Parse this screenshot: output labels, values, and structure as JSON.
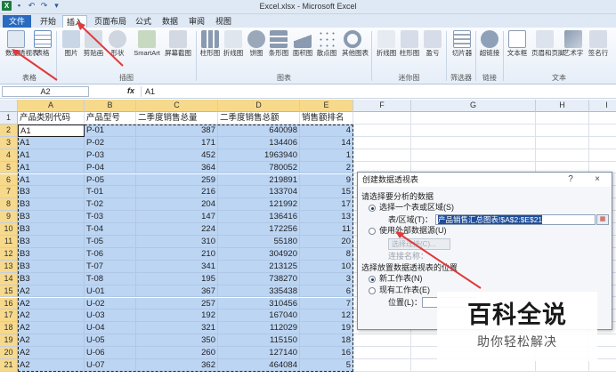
{
  "window": {
    "title": "Excel.xlsx - Microsoft Excel"
  },
  "tabs": [
    "文件",
    "开始",
    "插入",
    "页面布局",
    "公式",
    "数据",
    "审阅",
    "视图"
  ],
  "active_tab": "插入",
  "ribbon": {
    "buttons": [
      "数据透视表",
      "表格",
      "图片",
      "剪贴画",
      "形状",
      "SmartArt",
      "屏幕截图",
      "柱形图",
      "折线图",
      "饼图",
      "条形图",
      "面积图",
      "散点图",
      "其他图表",
      "折线图",
      "柱形图",
      "盈亏",
      "切片器",
      "超链接",
      "文本框",
      "页眉和页脚",
      "艺术字",
      "签名行"
    ],
    "groups": [
      "表格",
      "插图",
      "图表",
      "迷你图",
      "筛选器",
      "链接",
      "文本"
    ]
  },
  "formula_bar": {
    "name_box": "A2",
    "fx": "fx",
    "content": "A1"
  },
  "columns": [
    "A",
    "B",
    "C",
    "D",
    "E",
    "F",
    "G",
    "H",
    "I"
  ],
  "rows": [
    "1",
    "2",
    "3",
    "4",
    "5",
    "6",
    "7",
    "8",
    "9",
    "10",
    "11",
    "12",
    "13",
    "14",
    "15",
    "16",
    "17",
    "18",
    "19",
    "20",
    "21"
  ],
  "headers": [
    "产品类别代码",
    "产品型号",
    "二季度销售总量",
    "二季度销售总额",
    "销售额排名"
  ],
  "table": [
    [
      "A1",
      "P-01",
      "387",
      "640098",
      "4"
    ],
    [
      "A1",
      "P-02",
      "171",
      "134406",
      "14"
    ],
    [
      "A1",
      "P-03",
      "452",
      "1963940",
      "1"
    ],
    [
      "A1",
      "P-04",
      "364",
      "780052",
      "2"
    ],
    [
      "A1",
      "P-05",
      "259",
      "219891",
      "9"
    ],
    [
      "B3",
      "T-01",
      "216",
      "133704",
      "15"
    ],
    [
      "B3",
      "T-02",
      "204",
      "121992",
      "17"
    ],
    [
      "B3",
      "T-03",
      "147",
      "136416",
      "13"
    ],
    [
      "B3",
      "T-04",
      "224",
      "172256",
      "11"
    ],
    [
      "B3",
      "T-05",
      "310",
      "55180",
      "20"
    ],
    [
      "B3",
      "T-06",
      "210",
      "304920",
      "8"
    ],
    [
      "B3",
      "T-07",
      "341",
      "213125",
      "10"
    ],
    [
      "B3",
      "T-08",
      "195",
      "738270",
      "3"
    ],
    [
      "A2",
      "U-01",
      "367",
      "335438",
      "6"
    ],
    [
      "A2",
      "U-02",
      "257",
      "310456",
      "7"
    ],
    [
      "A2",
      "U-03",
      "192",
      "167040",
      "12"
    ],
    [
      "A2",
      "U-04",
      "321",
      "112029",
      "19"
    ],
    [
      "A2",
      "U-05",
      "350",
      "115150",
      "18"
    ],
    [
      "A2",
      "U-06",
      "260",
      "127140",
      "16"
    ],
    [
      "A2",
      "U-07",
      "362",
      "464084",
      "5"
    ]
  ],
  "dialog": {
    "title": "创建数据透视表",
    "help": "?",
    "close": "×",
    "section1": "请选择要分析的数据",
    "opt_range": "选择一个表或区域(S)",
    "range_label": "表/区域(T)：",
    "range_value": "产品销售汇总图表!$A$2:$E$21",
    "opt_external": "使用外部数据源(U)",
    "choose_conn": "选择连接(C)...",
    "conn_name": "连接名称：",
    "section2": "选择放置数据透视表的位置",
    "opt_new": "新工作表(N)",
    "opt_existing": "现有工作表(E)",
    "location_label": "位置(L)："
  },
  "watermark": {
    "big": "百科全说",
    "small": "助你轻松解决"
  }
}
